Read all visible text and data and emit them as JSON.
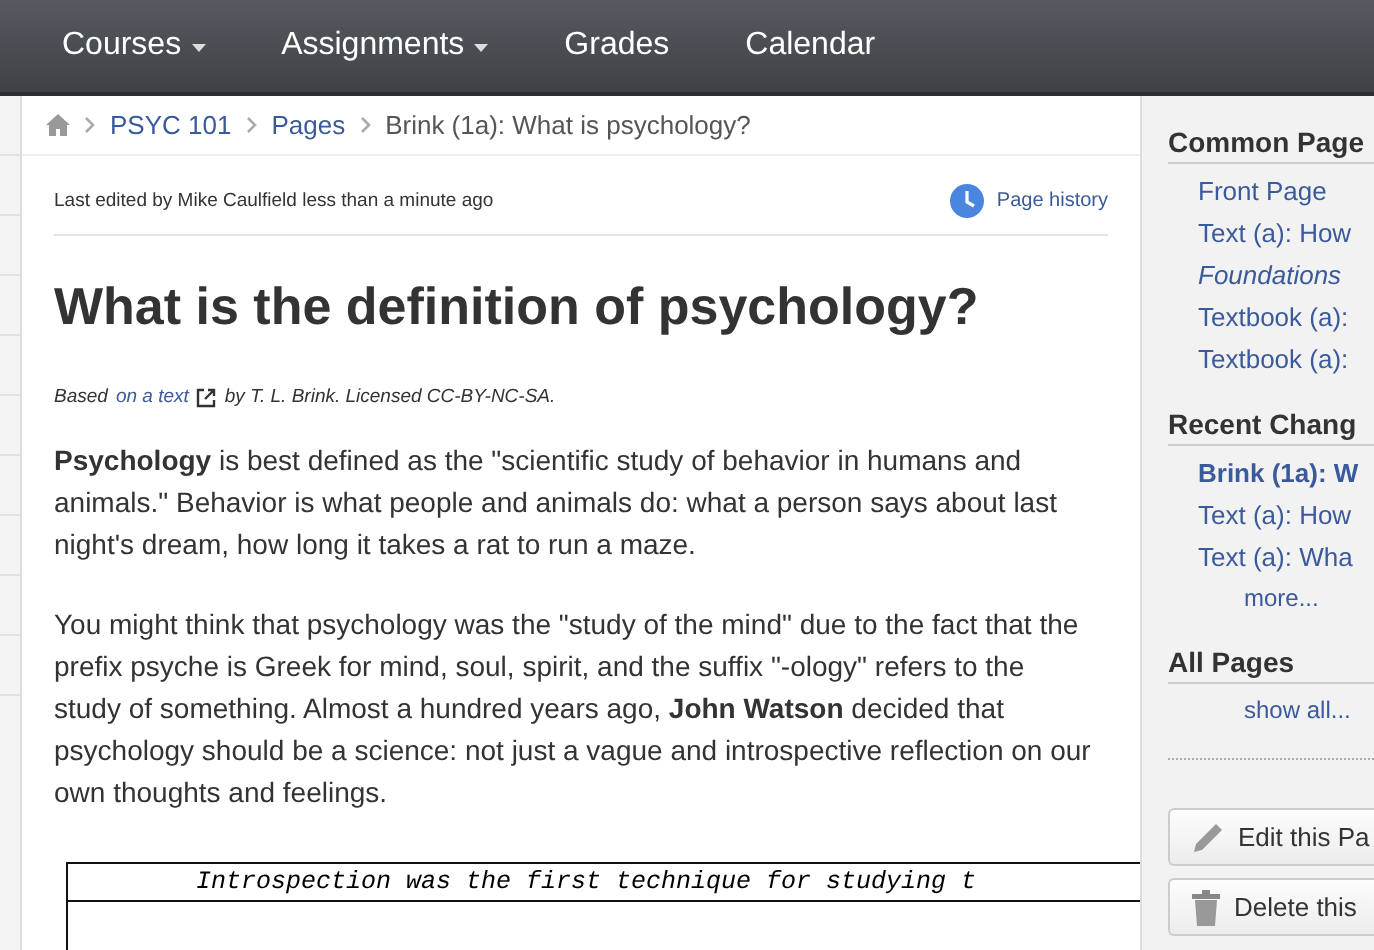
{
  "nav": [
    {
      "label": "Courses",
      "dropdown": true
    },
    {
      "label": "Assignments",
      "dropdown": true
    },
    {
      "label": "Grades",
      "dropdown": false
    },
    {
      "label": "Calendar",
      "dropdown": false
    }
  ],
  "breadcrumb": [
    "PSYC 101",
    "Pages",
    "Brink (1a): What is psychology?"
  ],
  "last_edited": "Last edited by Mike Caulfield less than a minute ago",
  "page_history": "Page history",
  "title": "What is the definition of psychology?",
  "attribution": {
    "before": "Based",
    "link": "on a text",
    "after": "by T. L. Brink. Licensed CC-BY-NC-SA."
  },
  "paragraphs": [
    "**Psychology** is best defined as the \"scientific study of behavior in humans and animals.\" Behavior is what people and animals do: what a person says about last night's dream, how long it takes a rat to run a maze.",
    "You might think that psychology was the \"study of the mind\" due to the fact that the prefix psyche is Greek for mind, soul, spirit, and the suffix \"-ology\" refers to the study of something. Almost a hundred years ago, **John Watson** decided that psychology should be a science: not just a vague and introspective reflection on our own thoughts and feelings."
  ],
  "table_caption": "Introspection was the first technique for studying t",
  "sidebar": {
    "sections": [
      {
        "title": "Common Page",
        "items": [
          {
            "label": "Front Page",
            "bold": false,
            "italic": false
          },
          {
            "label": "Text (a): How",
            "bold": false,
            "italic": false
          },
          {
            "label": "Foundations",
            "bold": false,
            "italic": true
          },
          {
            "label": "Textbook (a):",
            "bold": false,
            "italic": false
          },
          {
            "label": "Textbook (a):",
            "bold": false,
            "italic": false
          }
        ]
      },
      {
        "title": "Recent Chang",
        "items": [
          {
            "label": "Brink (1a): W",
            "bold": true,
            "italic": false
          },
          {
            "label": "Text (a): How",
            "bold": false,
            "italic": false
          },
          {
            "label": "Text (a): Wha",
            "bold": false,
            "italic": false
          }
        ],
        "more": "more..."
      },
      {
        "title": "All Pages",
        "more": "show all..."
      }
    ],
    "buttons": [
      {
        "kind": "edit",
        "label": "Edit this Pa"
      },
      {
        "kind": "delete",
        "label": "Delete this"
      }
    ]
  }
}
